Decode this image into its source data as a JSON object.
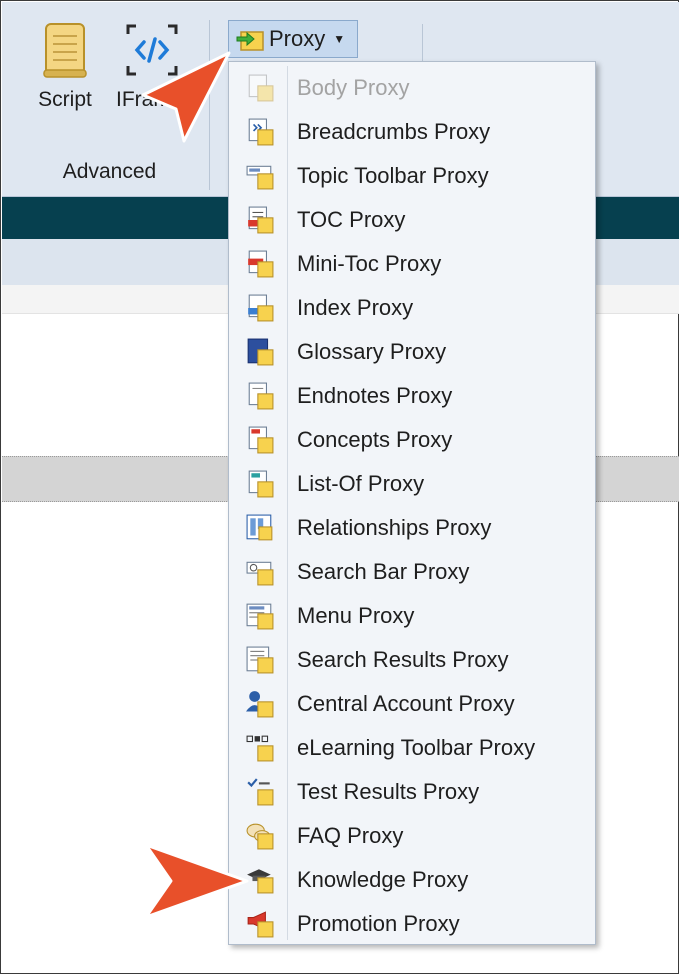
{
  "ribbon": {
    "script_label": "Script",
    "iframe_label": "IFrame",
    "group_label": "Advanced",
    "proxy_label": "Proxy"
  },
  "menu": {
    "items": [
      {
        "label": "Body Proxy",
        "icon": "body-proxy-icon",
        "enabled": false
      },
      {
        "label": "Breadcrumbs Proxy",
        "icon": "breadcrumbs-proxy-icon",
        "enabled": true
      },
      {
        "label": "Topic Toolbar Proxy",
        "icon": "topic-toolbar-proxy-icon",
        "enabled": true
      },
      {
        "label": "TOC Proxy",
        "icon": "toc-proxy-icon",
        "enabled": true
      },
      {
        "label": "Mini-Toc Proxy",
        "icon": "mini-toc-proxy-icon",
        "enabled": true
      },
      {
        "label": "Index Proxy",
        "icon": "index-proxy-icon",
        "enabled": true
      },
      {
        "label": "Glossary Proxy",
        "icon": "glossary-proxy-icon",
        "enabled": true
      },
      {
        "label": "Endnotes Proxy",
        "icon": "endnotes-proxy-icon",
        "enabled": true
      },
      {
        "label": "Concepts Proxy",
        "icon": "concepts-proxy-icon",
        "enabled": true
      },
      {
        "label": "List-Of Proxy",
        "icon": "list-of-proxy-icon",
        "enabled": true
      },
      {
        "label": "Relationships Proxy",
        "icon": "relationships-proxy-icon",
        "enabled": true
      },
      {
        "label": "Search Bar Proxy",
        "icon": "search-bar-proxy-icon",
        "enabled": true
      },
      {
        "label": "Menu Proxy",
        "icon": "menu-proxy-icon",
        "enabled": true
      },
      {
        "label": "Search Results Proxy",
        "icon": "search-results-proxy-icon",
        "enabled": true
      },
      {
        "label": "Central Account Proxy",
        "icon": "central-account-proxy-icon",
        "enabled": true
      },
      {
        "label": "eLearning Toolbar Proxy",
        "icon": "elearning-toolbar-proxy-icon",
        "enabled": true
      },
      {
        "label": "Test Results Proxy",
        "icon": "test-results-proxy-icon",
        "enabled": true
      },
      {
        "label": "FAQ Proxy",
        "icon": "faq-proxy-icon",
        "enabled": true
      },
      {
        "label": "Knowledge Proxy",
        "icon": "knowledge-proxy-icon",
        "enabled": true
      },
      {
        "label": "Promotion Proxy",
        "icon": "promotion-proxy-icon",
        "enabled": true
      }
    ]
  },
  "colors": {
    "ribbon_bg": "#dfe7f1",
    "dark_bar": "#06404f",
    "menu_bg": "#f2f5f9",
    "callout_arrow": "#e8502a",
    "icon_yellow": "#f7d24e"
  }
}
